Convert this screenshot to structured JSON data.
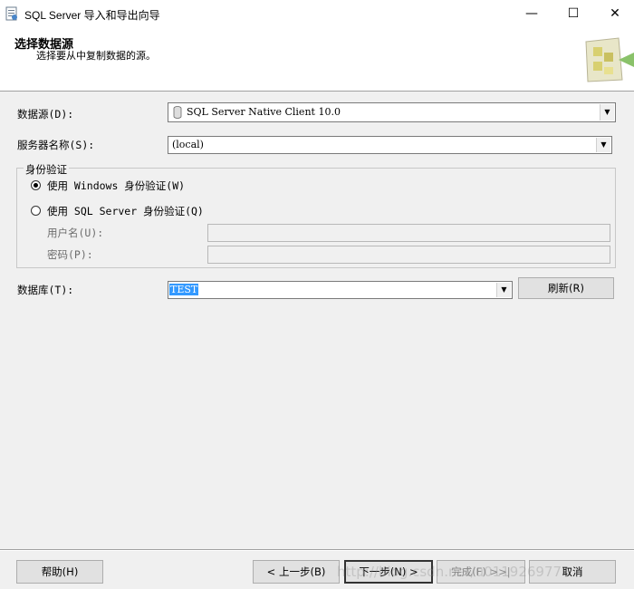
{
  "window": {
    "title": "SQL Server 导入和导出向导",
    "minimize": "—",
    "maximize": "☐",
    "close": "✕"
  },
  "header": {
    "title": "选择数据源",
    "subtitle": "选择要从中复制数据的源。"
  },
  "form": {
    "datasource_label": "数据源(D):",
    "datasource_value": "SQL Server Native Client 10.0",
    "server_label": "服务器名称(S):",
    "server_value": "(local)",
    "auth_group_label": "身份验证",
    "windows_auth_label": "使用 Windows 身份验证(W)",
    "sql_auth_label": "使用 SQL Server 身份验证(Q)",
    "username_label": "用户名(U):",
    "password_label": "密码(P):",
    "database_label": "数据库(T):",
    "database_value": "TEST",
    "refresh_label": "刷新(R)",
    "selected_auth": "windows"
  },
  "footer": {
    "help": "帮助(H)",
    "back": "< 上一步(B)",
    "next": "下一步(N) >",
    "finish": "完成(F) >>|",
    "cancel": "取消"
  },
  "watermark": "http://blog.csdn.net/u011926977",
  "icons": {
    "app": "wizard-app-icon",
    "datasource": "database-cylinder-icon",
    "dropdown": "chevron-down-icon",
    "wizard_graphic": "wizard-graphic-icon"
  }
}
